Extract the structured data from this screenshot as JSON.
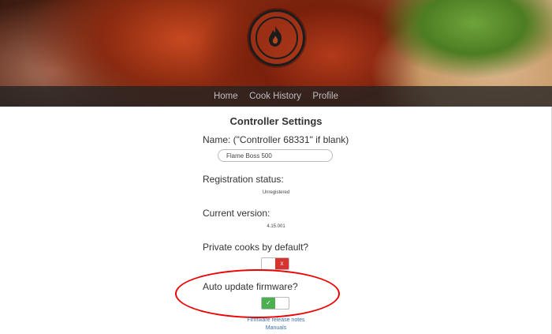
{
  "nav": {
    "items": [
      "Home",
      "Cook History",
      "Profile"
    ]
  },
  "logo": {
    "icon": "flame-boss-logo"
  },
  "page": {
    "title": "Controller Settings"
  },
  "name_field": {
    "label": "Name: (\"Controller 68331\" if blank)",
    "value": "Flame Boss 500"
  },
  "registration": {
    "label": "Registration status:",
    "value": "Unregistered"
  },
  "version": {
    "label": "Current version:",
    "value": "4.15.001"
  },
  "private_cooks": {
    "label": "Private cooks by default?",
    "state": "off",
    "icon": "x"
  },
  "auto_update": {
    "label": "Auto update firmware?",
    "state": "on",
    "icon": "✓"
  },
  "links": {
    "release_notes": "Firmware release notes",
    "manuals": "Manuals"
  },
  "colors": {
    "toggle_off": "#d8322f",
    "toggle_on": "#4caf50",
    "annotation": "#e00000",
    "link": "#3a6fb0"
  }
}
